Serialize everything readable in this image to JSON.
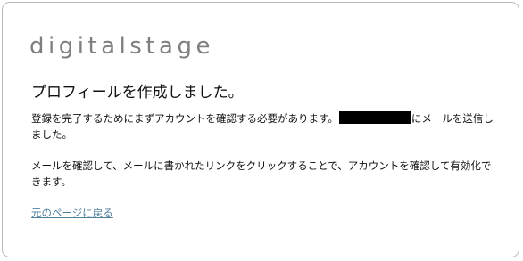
{
  "brand": {
    "logo_text": "digitalstage"
  },
  "main": {
    "title": "プロフィールを作成しました。",
    "paragraph1_before": "登録を完了するためにまずアカウントを確認する必要があります。",
    "paragraph1_after": "にメールを送信しました。",
    "paragraph2": "メールを確認して、メールに書かれたリンクをクリックすることで、アカウントを確認して有効化できます。",
    "back_link": "元のページに戻る"
  },
  "colors": {
    "logo": "#7f7f7f",
    "link": "#4f7f9e",
    "border": "#b9b9b9",
    "redaction": "#000000"
  }
}
